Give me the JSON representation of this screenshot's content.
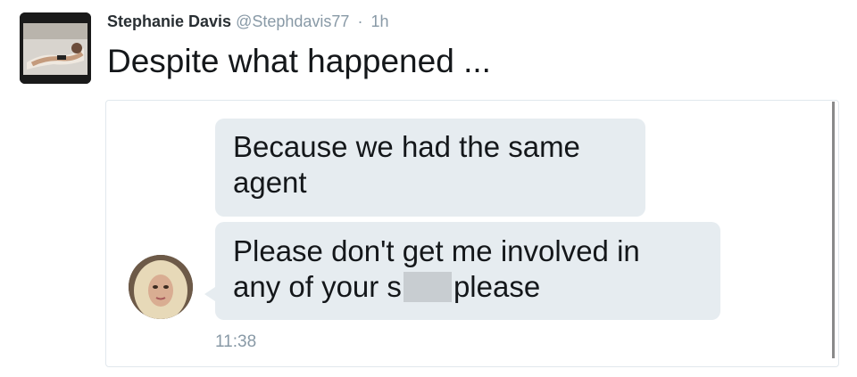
{
  "tweet": {
    "author_name": "Stephanie Davis",
    "handle": "@Stephdavis77",
    "separator": "·",
    "time": "1h",
    "text": "Despite what happened ..."
  },
  "dm": {
    "messages": [
      {
        "line1": "Because we had the same",
        "line2": "agent"
      },
      {
        "line1": "Please don't get me involved in",
        "line2_before": "any of your s",
        "line2_after": "please"
      }
    ],
    "timestamp": "11:38"
  }
}
